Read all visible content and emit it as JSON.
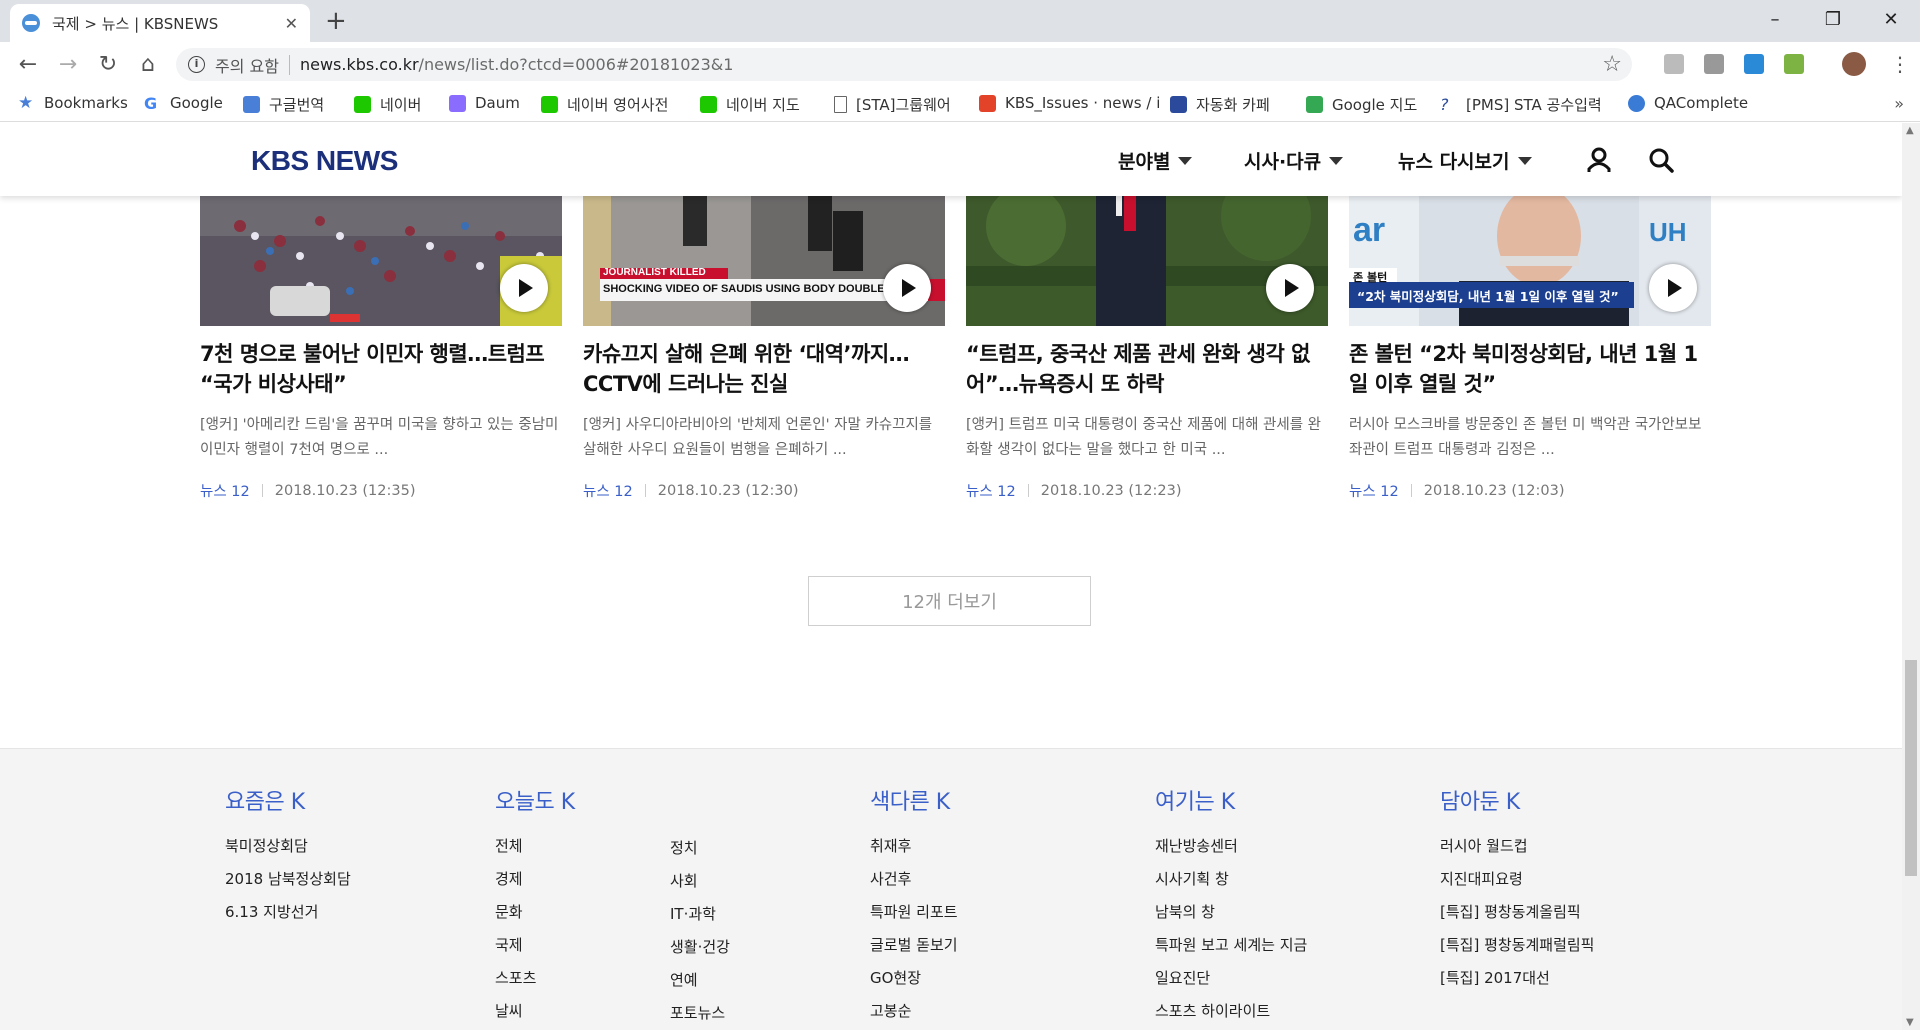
{
  "browser": {
    "tab_title": "국제 > 뉴스 | KBSNEWS",
    "tab_close": "✕",
    "new_tab": "+",
    "security_label": "주의 요함",
    "url_host": "news.kbs.co.kr",
    "url_path": "/news/list.do?ctcd=0006#20181023&1",
    "bookmarks": [
      {
        "label": "Bookmarks",
        "icon": "star-icon",
        "color": "#4a7fd8"
      },
      {
        "label": "Google",
        "icon": "google-icon",
        "color": "#4285f4"
      },
      {
        "label": "구글번역",
        "icon": "translate-icon",
        "color": "#4a7fd8"
      },
      {
        "label": "네이버",
        "icon": "naver-icon",
        "color": "#1ec800"
      },
      {
        "label": "Daum",
        "icon": "daum-icon",
        "color": "#8a6cff"
      },
      {
        "label": "네이버 영어사전",
        "icon": "dict-icon",
        "color": "#1ec800"
      },
      {
        "label": "네이버 지도",
        "icon": "naver-icon",
        "color": "#1ec800"
      },
      {
        "label": "[STA]그룹웨어",
        "icon": "page-icon",
        "color": "#ffffff"
      },
      {
        "label": "KBS_Issues · news / i",
        "icon": "gitlab-icon",
        "color": "#e24329"
      },
      {
        "label": "자동화 카페",
        "icon": "sta-icon",
        "color": "#2b4a9b"
      },
      {
        "label": "Google 지도",
        "icon": "maps-icon",
        "color": "#34a853"
      },
      {
        "label": "[PMS] STA 공수입력",
        "icon": "pms-icon",
        "color": "#2b4a9b"
      },
      {
        "label": "QAComplete",
        "icon": "qacomplete-icon",
        "color": "#3a7bd5"
      }
    ],
    "bookmarks_more": "»"
  },
  "header": {
    "logo": "KBS NEWS",
    "nav": [
      {
        "label": "분야별"
      },
      {
        "label": "시사·다큐"
      },
      {
        "label": "뉴스 다시보기"
      }
    ]
  },
  "articles": [
    {
      "title": "7천 명으로 불어난 이민자 행렬…트럼프 “국가 비상사태”",
      "summary": "[앵커] '아메리칸 드림'을 꿈꾸며 미국을 향하고 있는 중남미 이민자 행렬이 7천여 명으로 ...",
      "channel": "뉴스 12",
      "date": "2018.10.23 (12:35)"
    },
    {
      "title": "카슈끄지 살해 은폐 위한 ‘대역’까지…CCTV에 드러나는 진실",
      "summary": "[앵커] 사우디아라비아의 '반체제 언론인' 자말 카슈끄지를 살해한 사우디 요원들이 범행을 은폐하기 ...",
      "channel": "뉴스 12",
      "date": "2018.10.23 (12:30)",
      "caption_top": "JOURNALIST KILLED",
      "caption_main": "SHOCKING VIDEO OF SAUDIS USING BODY DOUBLE IN COVER-UP"
    },
    {
      "title": "“트럼프, 중국산 제품 관세 완화 생각 없어”…뉴욕증시 또 하락",
      "summary": "[앵커] 트럼프 미국 대통령이 중국산 제품에 대해 관세를 완화할 생각이 없다는 말을 했다고 한 미국 ...",
      "channel": "뉴스 12",
      "date": "2018.10.23 (12:23)"
    },
    {
      "title": "존 볼턴 “2차 북미정상회담, 내년 1월 1일 이후 열릴 것”",
      "summary": "러시아 모스크바를 방문중인 존 볼턴 미 백악관 국가안보보좌관이 트럼프 대통령과 김정은 ...",
      "channel": "뉴스 12",
      "date": "2018.10.23 (12:03)",
      "caption_top": "존 볼턴",
      "caption_main": "“2차 북미정상회담, 내년 1월 1일 이후 열릴 것”"
    }
  ],
  "more_button": "12개 더보기",
  "footer": {
    "col1": {
      "title": "요즘은 K",
      "items": [
        "북미정상회담",
        "2018 남북정상회담",
        "6.13 지방선거"
      ]
    },
    "col2": {
      "title": "오늘도 K",
      "items_a": [
        "전체",
        "경제",
        "문화",
        "국제",
        "스포츠",
        "날씨"
      ],
      "items_b": [
        "정치",
        "사회",
        "IT·과학",
        "생활·건강",
        "연예",
        "포토뉴스"
      ]
    },
    "col3": {
      "title": "색다른 K",
      "items": [
        "취재후",
        "사건후",
        "특파원 리포트",
        "글로벌 돋보기",
        "GO현장",
        "고봉순"
      ]
    },
    "col4": {
      "title": "여기는 K",
      "items": [
        "재난방송센터",
        "시사기획 창",
        "남북의 창",
        "특파원 보고 세계는 지금",
        "일요진단",
        "스포츠 하이라이트"
      ]
    },
    "col5": {
      "title": "담아둔 K",
      "items": [
        "러시아 월드컵",
        "지진대피요령",
        "[특집] 평창동계올림픽",
        "[특집] 평창동계패럴림픽",
        "[특집] 2017대선"
      ]
    }
  }
}
